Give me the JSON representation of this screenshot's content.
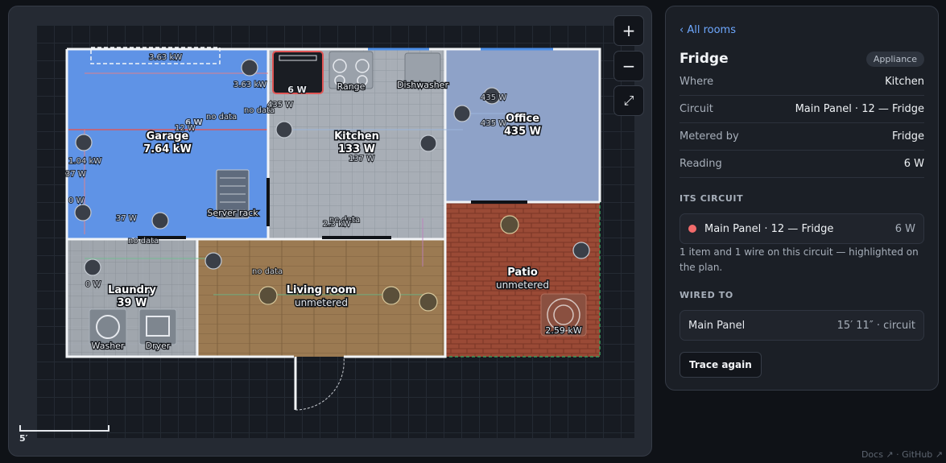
{
  "plan": {
    "rooms": [
      {
        "id": "garage",
        "name": "Garage",
        "reading": "7.64 kW"
      },
      {
        "id": "kitchen",
        "name": "Kitchen",
        "reading": "133 W"
      },
      {
        "id": "office",
        "name": "Office",
        "reading": "435 W"
      },
      {
        "id": "laundry",
        "name": "Laundry",
        "reading": "39 W"
      },
      {
        "id": "living",
        "name": "Living room",
        "reading": "unmetered"
      },
      {
        "id": "patio",
        "name": "Patio",
        "reading": "unmetered"
      }
    ],
    "items": {
      "fridge_reading": "6 W",
      "range": "Range",
      "dishwasher": "Dishwasher",
      "server_rack": "Server rack",
      "washer": "Washer",
      "dryer": "Dryer",
      "hot_tub_reading": "2.59 kW"
    },
    "annotations": {
      "garage_top": "3.63 kW",
      "garage_outlet": "3.63 kW",
      "garage_left1": "1.04 kW",
      "garage_left2": "37 W",
      "garage_left3": "0 W",
      "garage_bottom": "37 W",
      "garage_mid1": "6 W",
      "garage_mid2": "12 W",
      "no_data_1": "no data",
      "no_data_2": "no data",
      "no_data_3": "no data",
      "no_data_4": "no data",
      "no_data_5": "no data",
      "kitchen_435": "435 W",
      "kitchen_137": "137 W",
      "kitchen_23": "2.3 kW",
      "office_435a": "435 W",
      "office_435b": "435 W",
      "laundry_0": "0 W"
    },
    "scale_label": "5′"
  },
  "controls": {
    "zoom_in": "+",
    "zoom_out": "−",
    "fit": "⤢"
  },
  "panel": {
    "back": "‹ All rooms",
    "title": "Fridge",
    "badge": "Appliance",
    "rows": [
      {
        "key": "Where",
        "value": "Kitchen"
      },
      {
        "key": "Circuit",
        "value": "Main Panel · 12 — Fridge"
      },
      {
        "key": "Metered by",
        "value": "Fridge"
      },
      {
        "key": "Reading",
        "value": "6 W"
      }
    ],
    "circuit_heading": "ITS CIRCUIT",
    "circuit_name": "Main Panel · 12 — Fridge",
    "circuit_watts": "6 W",
    "circuit_note": "1 item and 1 wire on this circuit — highlighted on the plan.",
    "wired_heading": "WIRED TO",
    "wired_name": "Main Panel",
    "wired_meta": "15′ 11″ · circuit",
    "trace_button": "Trace again"
  },
  "footer": {
    "docs": "Docs ↗",
    "github": "GitHub ↗"
  },
  "colors": {
    "accent": "#6ea8fe",
    "circuit_dot": "#f26b6b",
    "highlight": "#e05555"
  }
}
